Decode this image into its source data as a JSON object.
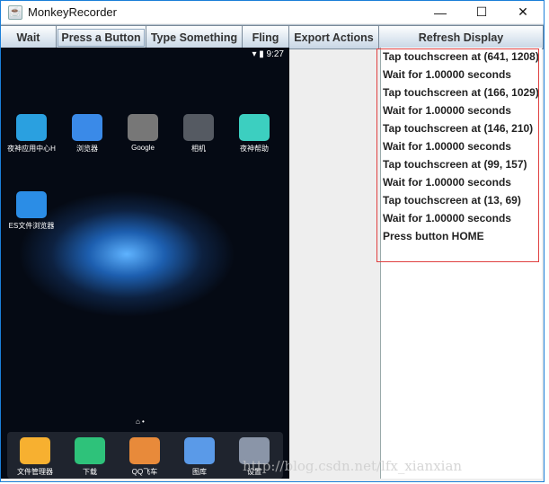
{
  "window": {
    "title": "MonkeyRecorder",
    "controls": [
      "—",
      "☐",
      "✕"
    ]
  },
  "toolbar": [
    "Wait",
    "Press a Button",
    "Type Something",
    "Fling",
    "Export Actions",
    "Refresh Display"
  ],
  "phone": {
    "time": "9:27",
    "status_icons": "▾ ▮",
    "apps": [
      {
        "label": "夜神应用中心H",
        "color": "#2aa0e0"
      },
      {
        "label": "浏览器",
        "color": "#3a8ae8"
      },
      {
        "label": "Google",
        "color": "#777"
      },
      {
        "label": "相机",
        "color": "#555a62"
      },
      {
        "label": "夜神帮助",
        "color": "#3ccfc0"
      },
      {
        "label": "ES文件浏览器",
        "color": "#2b8de6"
      }
    ],
    "dock": [
      {
        "label": "文件管理器",
        "color": "#f7b030"
      },
      {
        "label": "下载",
        "color": "#2ec27a"
      },
      {
        "label": "QQ飞车",
        "color": "#e88a3a"
      },
      {
        "label": "图库",
        "color": "#5a9ae8"
      },
      {
        "label": "设置",
        "color": "#8a95a8"
      }
    ],
    "page_dots": "⌂ •"
  },
  "actions": [
    "Tap touchscreen at (641, 1208)",
    "Wait for 1.00000 seconds",
    "Tap touchscreen at (166, 1029)",
    "Wait for 1.00000 seconds",
    "Tap touchscreen at (146, 210)",
    "Wait for 1.00000 seconds",
    "Tap touchscreen at (99, 157)",
    "Wait for 1.00000 seconds",
    "Tap touchscreen at (13, 69)",
    "Wait for 1.00000 seconds",
    "Press button HOME"
  ],
  "watermark": "http://blog.csdn.net/lfx_xianxian"
}
